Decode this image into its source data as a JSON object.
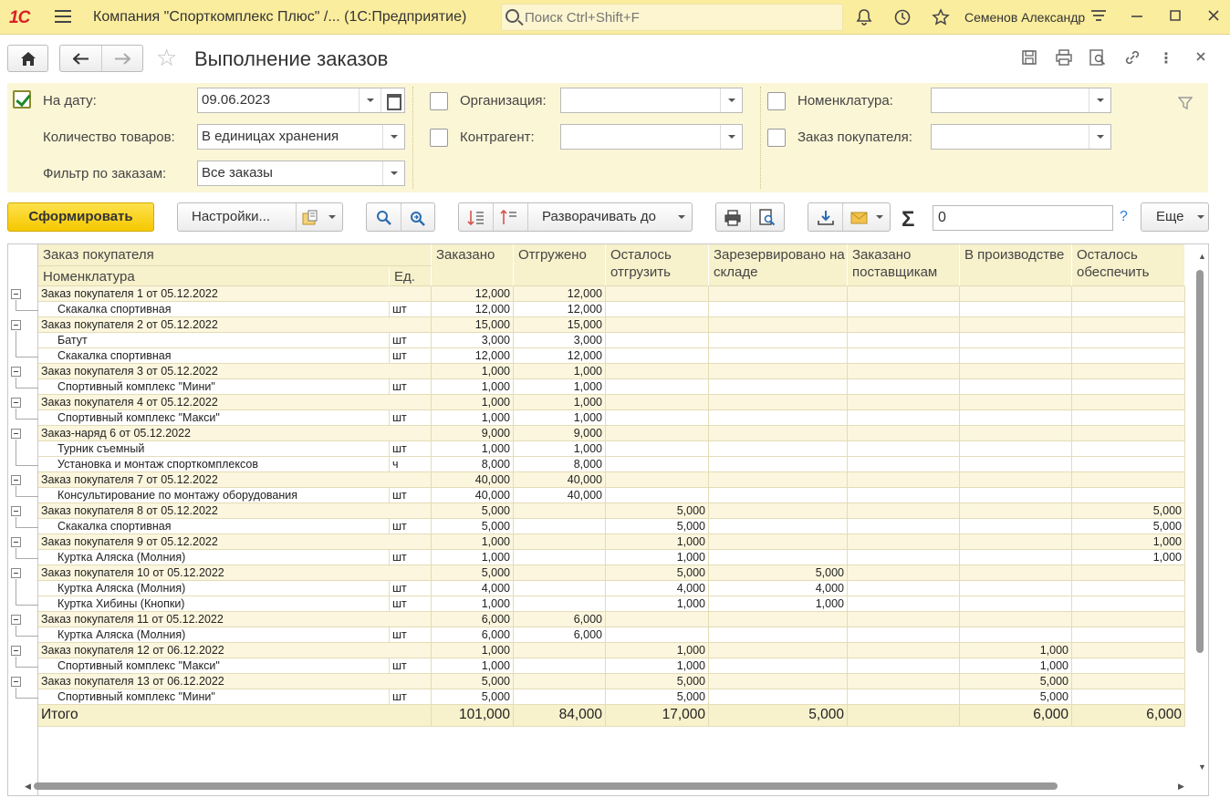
{
  "titlebar": {
    "logo": "1С",
    "app_title": "Компания \"Спорткомплекс Плюс\" /...  (1С:Предприятие)",
    "search_placeholder": "Поиск Ctrl+Shift+F",
    "user": "Семенов Александр"
  },
  "header": {
    "title": "Выполнение заказов"
  },
  "filters": {
    "date_label": "На дату:",
    "date_value": "09.06.2023",
    "qty_label": "Количество товаров:",
    "qty_value": "В единицах хранения",
    "order_filter_label": "Фильтр по заказам:",
    "order_filter_value": "Все заказы",
    "org_label": "Организация:",
    "org_value": "",
    "contractor_label": "Контрагент:",
    "contractor_value": "",
    "nomenclature_label": "Номенклатура:",
    "nomenclature_value": "",
    "customer_order_label": "Заказ покупателя:",
    "customer_order_value": ""
  },
  "toolbar": {
    "generate": "Сформировать",
    "settings": "Настройки...",
    "expand_to": "Разворачивать до",
    "sum_value": "0",
    "help": "?",
    "more": "Еще"
  },
  "table": {
    "headers": {
      "order": "Заказ покупателя",
      "nomenclature": "Номенклатура",
      "unit": "Ед.",
      "ordered": "Заказано",
      "shipped": "Отгружено",
      "remaining_ship": "Осталось отгрузить",
      "reserved": "Зарезервировано на складе",
      "ordered_suppliers": "Заказано поставщикам",
      "in_production": "В производстве",
      "remaining_provide": "Осталось обеспечить"
    },
    "rows": [
      {
        "group": true,
        "name": "Заказ покупателя 1 от 05.12.2022",
        "unit": "",
        "ordered": "12,000",
        "shipped": "12,000",
        "rem": "",
        "res": "",
        "sup": "",
        "prod": "",
        "prov": ""
      },
      {
        "group": false,
        "name": "Скакалка спортивная",
        "unit": "шт",
        "ordered": "12,000",
        "shipped": "12,000",
        "rem": "",
        "res": "",
        "sup": "",
        "prod": "",
        "prov": ""
      },
      {
        "group": true,
        "name": "Заказ покупателя 2 от 05.12.2022",
        "unit": "",
        "ordered": "15,000",
        "shipped": "15,000",
        "rem": "",
        "res": "",
        "sup": "",
        "prod": "",
        "prov": ""
      },
      {
        "group": false,
        "name": "Батут",
        "unit": "шт",
        "ordered": "3,000",
        "shipped": "3,000",
        "rem": "",
        "res": "",
        "sup": "",
        "prod": "",
        "prov": ""
      },
      {
        "group": false,
        "name": "Скакалка спортивная",
        "unit": "шт",
        "ordered": "12,000",
        "shipped": "12,000",
        "rem": "",
        "res": "",
        "sup": "",
        "prod": "",
        "prov": ""
      },
      {
        "group": true,
        "name": "Заказ покупателя 3 от 05.12.2022",
        "unit": "",
        "ordered": "1,000",
        "shipped": "1,000",
        "rem": "",
        "res": "",
        "sup": "",
        "prod": "",
        "prov": ""
      },
      {
        "group": false,
        "name": "Спортивный комплекс \"Мини\"",
        "unit": "шт",
        "ordered": "1,000",
        "shipped": "1,000",
        "rem": "",
        "res": "",
        "sup": "",
        "prod": "",
        "prov": ""
      },
      {
        "group": true,
        "name": "Заказ покупателя 4 от 05.12.2022",
        "unit": "",
        "ordered": "1,000",
        "shipped": "1,000",
        "rem": "",
        "res": "",
        "sup": "",
        "prod": "",
        "prov": ""
      },
      {
        "group": false,
        "name": "Спортивный комплекс \"Макси\"",
        "unit": "шт",
        "ordered": "1,000",
        "shipped": "1,000",
        "rem": "",
        "res": "",
        "sup": "",
        "prod": "",
        "prov": ""
      },
      {
        "group": true,
        "name": "Заказ-наряд 6 от 05.12.2022",
        "unit": "",
        "ordered": "9,000",
        "shipped": "9,000",
        "rem": "",
        "res": "",
        "sup": "",
        "prod": "",
        "prov": ""
      },
      {
        "group": false,
        "name": "Турник съемный",
        "unit": "шт",
        "ordered": "1,000",
        "shipped": "1,000",
        "rem": "",
        "res": "",
        "sup": "",
        "prod": "",
        "prov": ""
      },
      {
        "group": false,
        "name": "Установка и монтаж спорткомплексов",
        "unit": "ч",
        "ordered": "8,000",
        "shipped": "8,000",
        "rem": "",
        "res": "",
        "sup": "",
        "prod": "",
        "prov": ""
      },
      {
        "group": true,
        "name": "Заказ покупателя 7 от 05.12.2022",
        "unit": "",
        "ordered": "40,000",
        "shipped": "40,000",
        "rem": "",
        "res": "",
        "sup": "",
        "prod": "",
        "prov": ""
      },
      {
        "group": false,
        "name": "Консультирование по монтажу оборудования",
        "unit": "шт",
        "ordered": "40,000",
        "shipped": "40,000",
        "rem": "",
        "res": "",
        "sup": "",
        "prod": "",
        "prov": ""
      },
      {
        "group": true,
        "name": "Заказ покупателя 8 от 05.12.2022",
        "unit": "",
        "ordered": "5,000",
        "shipped": "",
        "rem": "5,000",
        "res": "",
        "sup": "",
        "prod": "",
        "prov": "5,000"
      },
      {
        "group": false,
        "name": "Скакалка спортивная",
        "unit": "шт",
        "ordered": "5,000",
        "shipped": "",
        "rem": "5,000",
        "res": "",
        "sup": "",
        "prod": "",
        "prov": "5,000"
      },
      {
        "group": true,
        "name": "Заказ покупателя 9 от 05.12.2022",
        "unit": "",
        "ordered": "1,000",
        "shipped": "",
        "rem": "1,000",
        "res": "",
        "sup": "",
        "prod": "",
        "prov": "1,000"
      },
      {
        "group": false,
        "name": "Куртка Аляска (Молния)",
        "unit": "шт",
        "ordered": "1,000",
        "shipped": "",
        "rem": "1,000",
        "res": "",
        "sup": "",
        "prod": "",
        "prov": "1,000"
      },
      {
        "group": true,
        "name": "Заказ покупателя 10 от 05.12.2022",
        "unit": "",
        "ordered": "5,000",
        "shipped": "",
        "rem": "5,000",
        "res": "5,000",
        "sup": "",
        "prod": "",
        "prov": ""
      },
      {
        "group": false,
        "name": "Куртка Аляска (Молния)",
        "unit": "шт",
        "ordered": "4,000",
        "shipped": "",
        "rem": "4,000",
        "res": "4,000",
        "sup": "",
        "prod": "",
        "prov": ""
      },
      {
        "group": false,
        "name": "Куртка Хибины (Кнопки)",
        "unit": "шт",
        "ordered": "1,000",
        "shipped": "",
        "rem": "1,000",
        "res": "1,000",
        "sup": "",
        "prod": "",
        "prov": ""
      },
      {
        "group": true,
        "name": "Заказ покупателя 11 от 05.12.2022",
        "unit": "",
        "ordered": "6,000",
        "shipped": "6,000",
        "rem": "",
        "res": "",
        "sup": "",
        "prod": "",
        "prov": ""
      },
      {
        "group": false,
        "name": "Куртка Аляска (Молния)",
        "unit": "шт",
        "ordered": "6,000",
        "shipped": "6,000",
        "rem": "",
        "res": "",
        "sup": "",
        "prod": "",
        "prov": ""
      },
      {
        "group": true,
        "name": "Заказ покупателя 12 от 06.12.2022",
        "unit": "",
        "ordered": "1,000",
        "shipped": "",
        "rem": "1,000",
        "res": "",
        "sup": "",
        "prod": "1,000",
        "prov": ""
      },
      {
        "group": false,
        "name": "Спортивный комплекс \"Макси\"",
        "unit": "шт",
        "ordered": "1,000",
        "shipped": "",
        "rem": "1,000",
        "res": "",
        "sup": "",
        "prod": "1,000",
        "prov": ""
      },
      {
        "group": true,
        "name": "Заказ покупателя 13 от 06.12.2022",
        "unit": "",
        "ordered": "5,000",
        "shipped": "",
        "rem": "5,000",
        "res": "",
        "sup": "",
        "prod": "5,000",
        "prov": ""
      },
      {
        "group": false,
        "name": "Спортивный комплекс \"Мини\"",
        "unit": "шт",
        "ordered": "5,000",
        "shipped": "",
        "rem": "5,000",
        "res": "",
        "sup": "",
        "prod": "5,000",
        "prov": ""
      }
    ],
    "total": {
      "label": "Итого",
      "ordered": "101,000",
      "shipped": "84,000",
      "rem": "17,000",
      "res": "5,000",
      "sup": "",
      "prod": "6,000",
      "prov": "6,000"
    }
  }
}
